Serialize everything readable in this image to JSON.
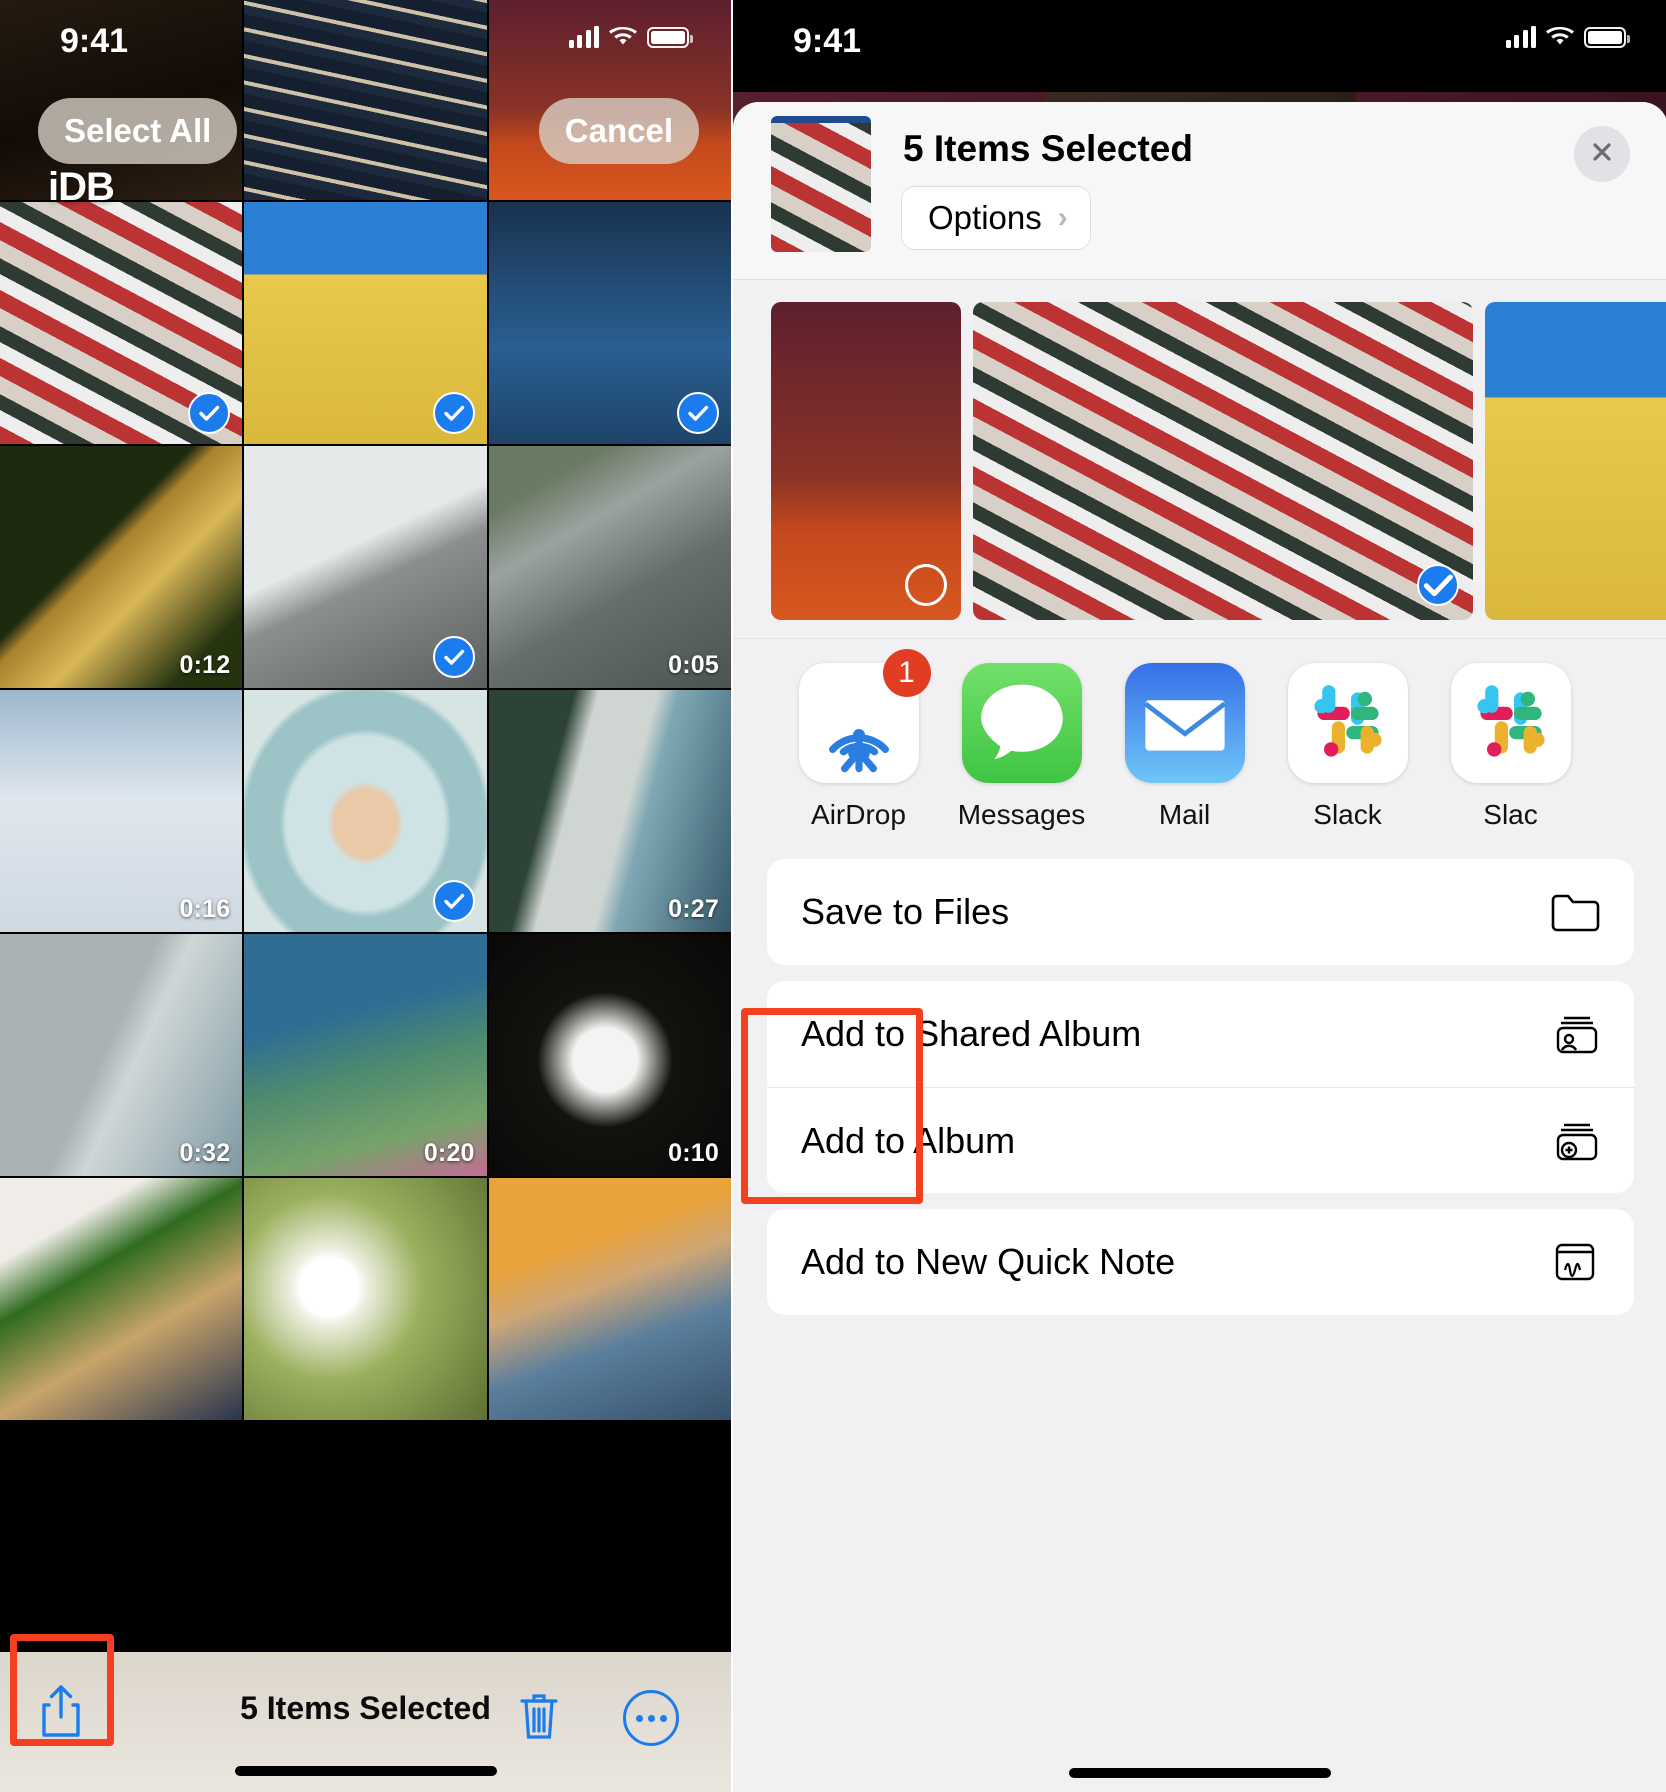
{
  "left_phone": {
    "status": {
      "time": "9:41",
      "signal_icon": "cellular-bars-icon",
      "wifi_icon": "wifi-icon",
      "battery_icon": "battery-icon"
    },
    "select_all_label": "Select All",
    "cancel_label": "Cancel",
    "watermark": "iDB",
    "grid": [
      {
        "duration": "",
        "selected": false,
        "img": "blurred-dark-field"
      },
      {
        "duration": "",
        "selected": false,
        "img": "light-streaks"
      },
      {
        "duration": "",
        "selected": false,
        "img": "red-dusk-tree"
      },
      {
        "duration": "",
        "selected": true,
        "img": "thread-spools"
      },
      {
        "duration": "",
        "selected": true,
        "img": "yellow-field"
      },
      {
        "duration": "",
        "selected": true,
        "img": "blue-sky-leaf"
      },
      {
        "duration": "0:12",
        "selected": false,
        "img": "honeycomb-bees"
      },
      {
        "duration": "",
        "selected": true,
        "img": "foggy-mountain-road"
      },
      {
        "duration": "0:05",
        "selected": false,
        "img": "aerial-city"
      },
      {
        "duration": "0:16",
        "selected": false,
        "img": "clouds"
      },
      {
        "duration": "",
        "selected": true,
        "img": "record-player"
      },
      {
        "duration": "0:27",
        "selected": false,
        "img": "beach-coastline"
      },
      {
        "duration": "0:32",
        "selected": false,
        "img": "shoreline-sand"
      },
      {
        "duration": "0:20",
        "selected": false,
        "img": "waterlilies"
      },
      {
        "duration": "0:10",
        "selected": false,
        "img": "tuxedo-cat"
      },
      {
        "duration": "",
        "selected": false,
        "img": "herbs-sauce"
      },
      {
        "duration": "",
        "selected": false,
        "img": "white-blossoms"
      },
      {
        "duration": "",
        "selected": false,
        "img": "chopsticks-bowl"
      }
    ],
    "toolbar": {
      "status_text": "5 Items Selected",
      "share_icon": "share-icon",
      "trash_icon": "trash-icon",
      "more_icon": "more-ellipsis-icon"
    },
    "highlight_color": "#f4401f"
  },
  "right_phone": {
    "status": {
      "time": "9:41",
      "signal_icon": "cellular-bars-icon",
      "wifi_icon": "wifi-icon",
      "battery_icon": "battery-icon"
    },
    "share_sheet": {
      "title": "5 Items Selected",
      "options_label": "Options",
      "options_chevron": "chevron-right-icon",
      "close_icon": "close-icon",
      "thumbnail": "thread-spools",
      "previews": [
        {
          "img": "red-dusk-tree",
          "selected": false
        },
        {
          "img": "thread-spools",
          "selected": true
        },
        {
          "img": "yellow-field",
          "selected": true
        }
      ],
      "apps": [
        {
          "label": "AirDrop",
          "icon": "airdrop-icon",
          "badge": "1",
          "highlighted": true
        },
        {
          "label": "Messages",
          "icon": "messages-icon",
          "badge": "",
          "highlighted": false
        },
        {
          "label": "Mail",
          "icon": "mail-icon",
          "badge": "",
          "highlighted": false
        },
        {
          "label": "Slack",
          "icon": "slack-icon",
          "badge": "",
          "highlighted": false
        },
        {
          "label": "Slac",
          "icon": "slack-icon",
          "badge": "",
          "highlighted": false
        }
      ],
      "action_groups": [
        {
          "rows": [
            {
              "label": "Save to Files",
              "icon": "folder-icon"
            }
          ]
        },
        {
          "rows": [
            {
              "label": "Add to Shared Album",
              "icon": "shared-album-icon"
            },
            {
              "label": "Add to Album",
              "icon": "add-album-icon"
            }
          ]
        },
        {
          "rows": [
            {
              "label": "Add to New Quick Note",
              "icon": "quick-note-icon"
            }
          ]
        }
      ]
    }
  },
  "colors": {
    "accent_blue": "#1b7ced",
    "highlight_red": "#f4401f",
    "badge_red": "#e03d23",
    "messages_green": "#4cd964",
    "mail_blue": "#2f7cf6",
    "sheet_bg": "#f1f1f3"
  }
}
